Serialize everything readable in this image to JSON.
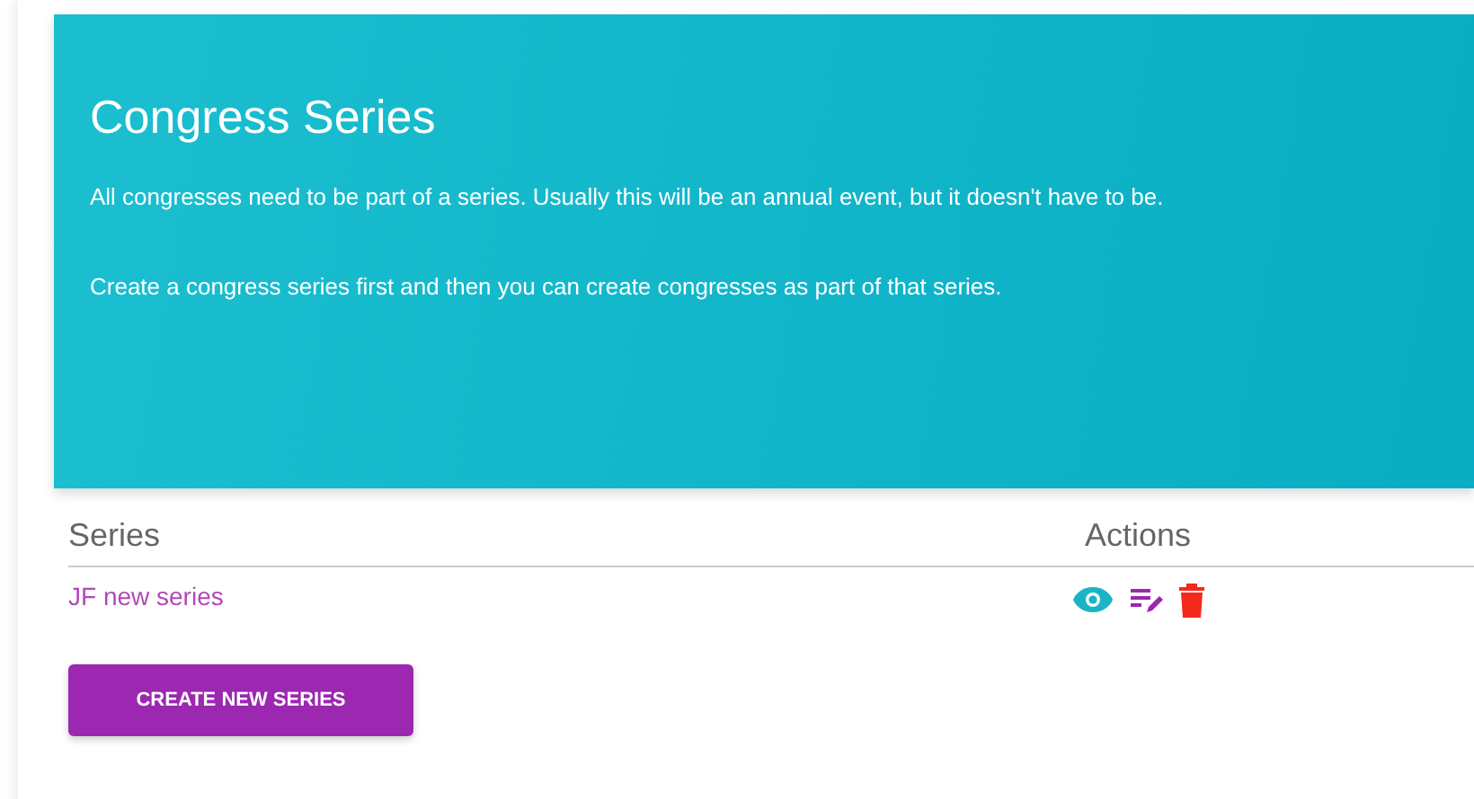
{
  "header": {
    "title": "Congress Series",
    "paragraphs": [
      "All congresses need to be part of a series. Usually this will be an annual event, but it doesn't have to be.",
      "Create a congress series first and then you can create congresses as part of that series."
    ]
  },
  "table": {
    "columns": [
      "Series",
      "Actions"
    ],
    "rows": [
      {
        "name": "JF new series",
        "actions": [
          {
            "kind": "view"
          },
          {
            "kind": "edit"
          },
          {
            "kind": "delete"
          }
        ]
      }
    ]
  },
  "create_button": "CREATE NEW SERIES"
}
